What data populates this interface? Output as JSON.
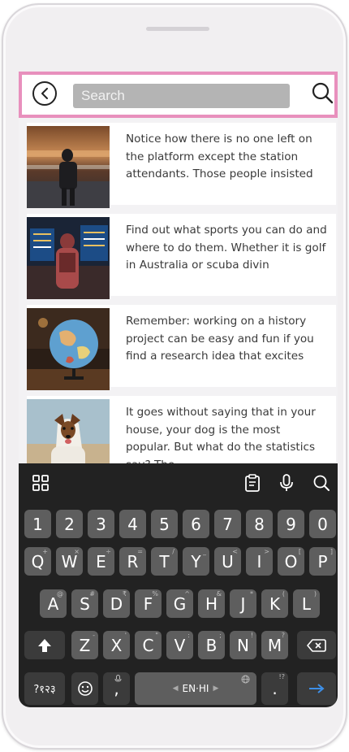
{
  "search": {
    "placeholder": "Search"
  },
  "articles": [
    {
      "text": "Notice how there is no one left on the platform except the station attendants. Those people insisted"
    },
    {
      "text": "Find out what sports you can do and where to do them. Whether it is golf in Australia or scuba divin"
    },
    {
      "text": "Remember: working on a history project can be easy and fun if you find a research idea that excites"
    },
    {
      "text": "It goes without saying that in your house, your dog is the most popular. But what do the statistics say? The"
    }
  ],
  "keyboard": {
    "toolbar_icons": [
      "apps-grid-icon",
      "clipboard-icon",
      "microphone-icon",
      "search-icon"
    ],
    "row_numbers": [
      "1",
      "2",
      "3",
      "4",
      "5",
      "6",
      "7",
      "8",
      "9",
      "0"
    ],
    "row_q": [
      {
        "k": "Q",
        "h": "+"
      },
      {
        "k": "W",
        "h": "×"
      },
      {
        "k": "E",
        "h": "÷"
      },
      {
        "k": "R",
        "h": "="
      },
      {
        "k": "T",
        "h": "/"
      },
      {
        "k": "Y",
        "h": "_"
      },
      {
        "k": "U",
        "h": "<"
      },
      {
        "k": "I",
        "h": ">"
      },
      {
        "k": "O",
        "h": "["
      },
      {
        "k": "P",
        "h": "]"
      }
    ],
    "row_a": [
      {
        "k": "A",
        "h": "@"
      },
      {
        "k": "S",
        "h": "#"
      },
      {
        "k": "D",
        "h": "₹"
      },
      {
        "k": "F",
        "h": "%"
      },
      {
        "k": "G",
        "h": "^"
      },
      {
        "k": "H",
        "h": "&"
      },
      {
        "k": "J",
        "h": "*"
      },
      {
        "k": "K",
        "h": "("
      },
      {
        "k": "L",
        "h": ")"
      }
    ],
    "row_z": [
      {
        "k": "Z",
        "h": "-"
      },
      {
        "k": "X",
        "h": "'"
      },
      {
        "k": "C",
        "h": "\""
      },
      {
        "k": "V",
        "h": ":"
      },
      {
        "k": "B",
        "h": ";"
      },
      {
        "k": "N",
        "h": "!"
      },
      {
        "k": "M",
        "h": "?"
      }
    ],
    "symbols_label": "?१२३",
    "comma": ",",
    "space_label": "EN·HI",
    "period": ".",
    "period_hint": "!?",
    "enter_color": "#3d8fe8"
  },
  "colors": {
    "highlight_border": "#e890bd",
    "search_fill": "#b4b4b4",
    "keyboard_bg": "#222222",
    "key_bg": "#5e5e5e"
  }
}
